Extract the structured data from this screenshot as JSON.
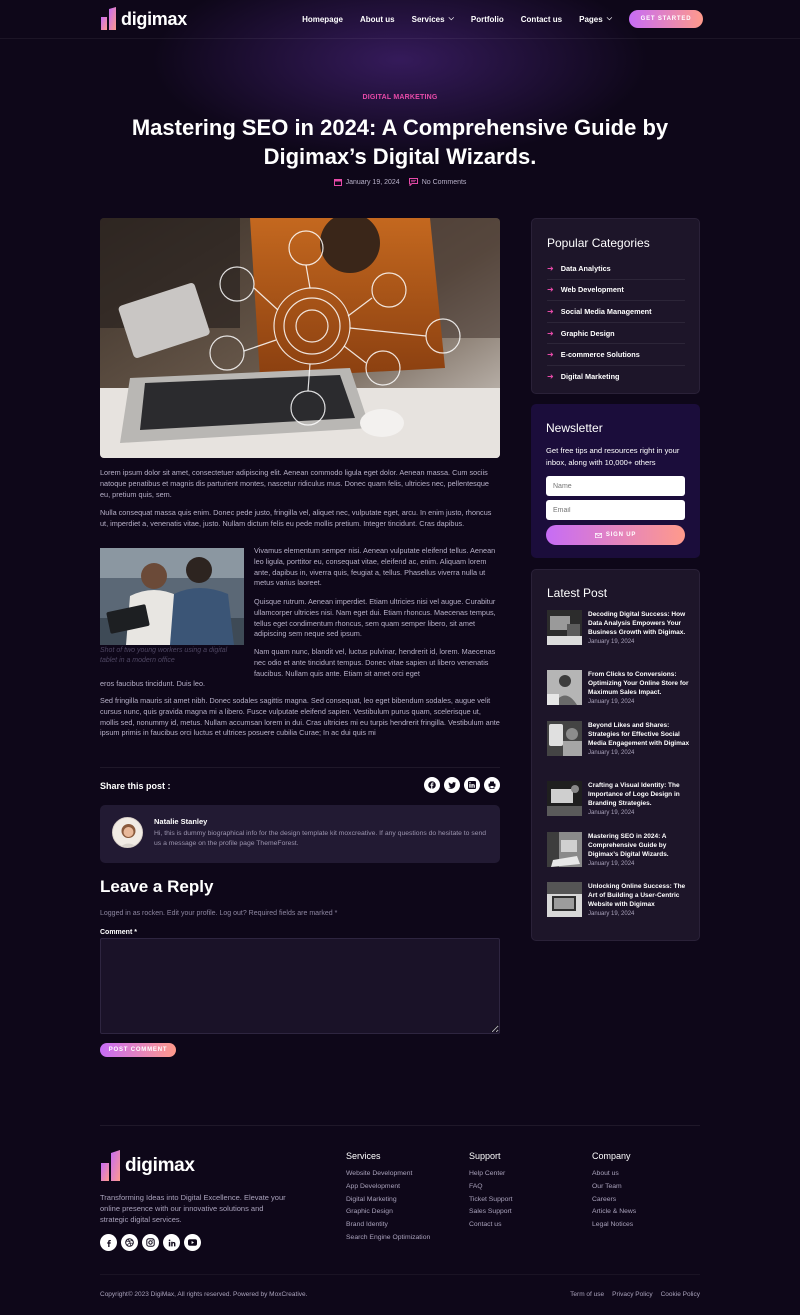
{
  "colors": {
    "background": "#0e0719",
    "accent_pink": "#e64aa8",
    "gradient_start": "#c66cf6",
    "gradient_end": "#ff9a8b",
    "newsletter_bg": "#1b0d3b"
  },
  "header": {
    "logo_text": "digimax",
    "nav": [
      {
        "label": "Homepage",
        "dropdown": false
      },
      {
        "label": "About us",
        "dropdown": false
      },
      {
        "label": "Services",
        "dropdown": true
      },
      {
        "label": "Portfolio",
        "dropdown": false
      },
      {
        "label": "Contact us",
        "dropdown": false
      },
      {
        "label": "Pages",
        "dropdown": true
      }
    ],
    "cta_label": "GET STARTED"
  },
  "post": {
    "category": "DIGITAL MARKETING",
    "title": "Mastering SEO in 2024: A Comprehensive Guide by Digimax’s Digital Wizards.",
    "date": "January 19, 2024",
    "comments": "No Comments",
    "paragraphs": [
      "Lorem ipsum dolor sit amet, consectetuer adipiscing elit. Aenean commodo ligula eget dolor. Aenean massa. Cum sociis natoque penatibus et magnis dis parturient montes, nascetur ridiculus mus. Donec quam felis, ultricies nec, pellentesque eu, pretium quis, sem.",
      "Nulla consequat massa quis enim. Donec pede justo, fringilla vel, aliquet nec, vulputate eget, arcu. In enim justo, rhoncus ut, imperdiet a, venenatis vitae, justo. Nullam dictum felis eu pede mollis pretium. Integer tincidunt. Cras dapibus.",
      "Vivamus elementum semper nisi. Aenean vulputate eleifend tellus. Aenean leo ligula, porttitor eu, consequat vitae, eleifend ac, enim. Aliquam lorem ante, dapibus in, viverra quis, feugiat a, tellus. Phasellus viverra nulla ut metus varius laoreet.",
      "Quisque rutrum. Aenean imperdiet. Etiam ultricies nisi vel augue. Curabitur ullamcorper ultricies nisi. Nam eget dui. Etiam rhoncus. Maecenas tempus, tellus eget condimentum rhoncus, sem quam semper libero, sit amet adipiscing sem neque sed ipsum.",
      "Nam quam nunc, blandit vel, luctus pulvinar, hendrerit id, lorem. Maecenas nec odio et ante tincidunt tempus. Donec vitae sapien ut libero venenatis faucibus. Nullam quis ante. Etiam sit amet orci eget",
      "eros faucibus tincidunt. Duis leo.",
      "Sed fringilla mauris sit amet nibh. Donec sodales sagittis magna. Sed consequat, leo eget bibendum sodales, augue velit cursus nunc, quis gravida magna mi a libero. Fusce vulputate eleifend sapien. Vestibulum purus quam, scelerisque ut, mollis sed, nonummy id, metus. Nullam accumsan lorem in dui. Cras ultricies mi eu turpis hendrerit fringilla. Vestibulum ante ipsum primis in faucibus orci luctus et ultrices posuere cubilia Curae; In ac dui quis mi"
    ],
    "image_caption": "Shot of two young workers using a digital tablet in a modern office",
    "share_label": "Share this post :",
    "share_icons": [
      "facebook-icon",
      "twitter-icon",
      "linkedin-icon",
      "print-icon"
    ]
  },
  "author": {
    "name": "Natalie Stanley",
    "bio": "Hi, this is dummy biographical info for the design template kit moxcreative. If any questions do hesitate to send us a message on the profile page ThemeForest."
  },
  "reply": {
    "title": "Leave a Reply",
    "logged_in": "Logged in as rocken. Edit your profile. Log out? Required fields are marked *",
    "comment_label": "Comment *",
    "button_label": "POST COMMENT"
  },
  "sidebar": {
    "popular_title": "Popular Categories",
    "categories": [
      "Data Analytics",
      "Web Development",
      "Social Media Management",
      "Graphic Design",
      "E-commerce Solutions",
      "Digital Marketing"
    ],
    "newsletter": {
      "title": "Newsletter",
      "text": "Get free tips and resources right in your inbox, along with 10,000+ others",
      "name_placeholder": "Name",
      "email_placeholder": "Email",
      "button_label": "SIGN UP"
    },
    "latest_title": "Latest Post",
    "latest_posts": [
      {
        "title": "Decoding Digital Success: How Data Analysis Empowers Your Business Growth with Digimax.",
        "date": "January 19, 2024"
      },
      {
        "title": "From Clicks to Conversions: Optimizing Your Online Store for Maximum Sales Impact.",
        "date": "January 19, 2024"
      },
      {
        "title": "Beyond Likes and Shares: Strategies for Effective Social Media Engagement with Digimax",
        "date": "January 19, 2024"
      },
      {
        "title": "Crafting a Visual Identity: The Importance of Logo Design in Branding Strategies.",
        "date": "January 19, 2024"
      },
      {
        "title": "Mastering SEO in 2024: A Comprehensive Guide by Digimax’s Digital Wizards.",
        "date": "January 19, 2024"
      },
      {
        "title": "Unlocking Online Success: The Art of Building a User-Centric Website with Digimax",
        "date": "January 19, 2024"
      }
    ]
  },
  "footer": {
    "logo_text": "digimax",
    "tagline": "Transforming Ideas into Digital Excellence. Elevate your online presence with our innovative solutions and strategic digital services.",
    "social_icons": [
      "facebook-icon",
      "dribbble-icon",
      "instagram-icon",
      "linkedin-icon",
      "youtube-icon"
    ],
    "columns": [
      {
        "title": "Services",
        "links": [
          "Website Development",
          "App Development",
          "Digital Marketing",
          "Graphic Design",
          "Brand Identity",
          "Search Engine Optimization"
        ]
      },
      {
        "title": "Support",
        "links": [
          "Help Center",
          "FAQ",
          "Ticket Support",
          "Sales Support",
          "Contact us"
        ]
      },
      {
        "title": "Company",
        "links": [
          "About us",
          "Our Team",
          "Careers",
          "Article & News",
          "Legal Notices"
        ]
      }
    ],
    "copyright": "Copyright© 2023 DigiMax, All rights reserved. Powered by MoxCreative.",
    "legal_links": [
      "Term of use",
      "Privacy Policy",
      "Cookie Policy"
    ]
  }
}
